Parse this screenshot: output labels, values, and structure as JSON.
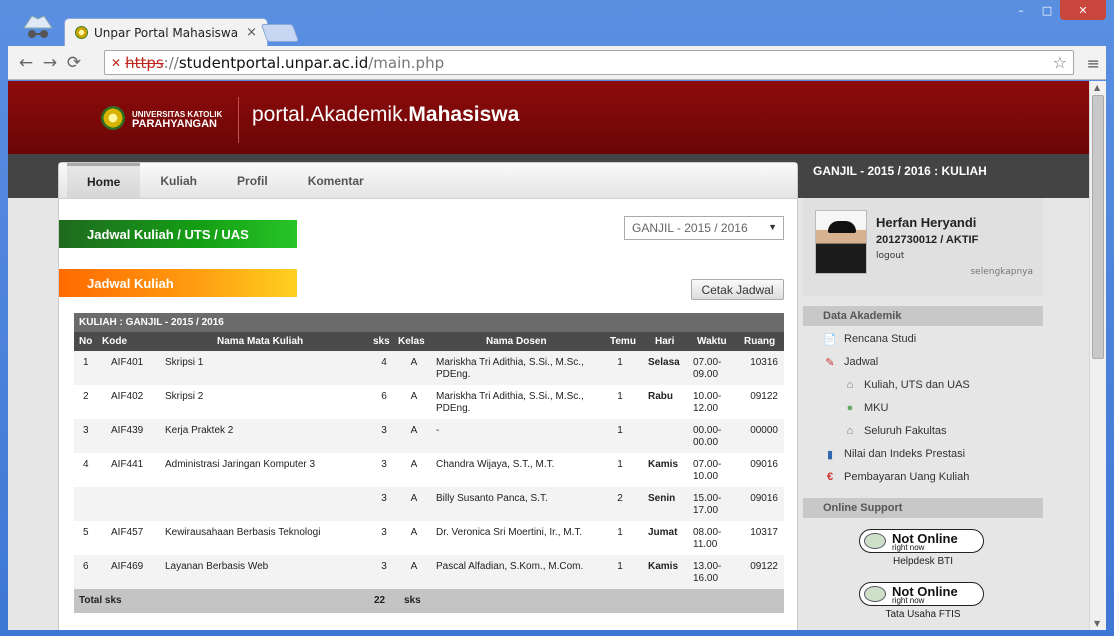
{
  "browser": {
    "tab_title": "Unpar Portal Mahasiswa",
    "tab_close": "×",
    "url_protocol": "https",
    "url_separator": "://",
    "url_host": "studentportal.unpar.ac.id",
    "url_path": "/main.php",
    "back": "←",
    "forward": "→",
    "reload": "⟳",
    "menu": "≡",
    "star": "☆",
    "win_min": "–",
    "win_max": "□",
    "win_close": "✕"
  },
  "header": {
    "uni_line1": "UNIVERSITAS KATOLIK",
    "uni_line2": "PARAHYANGAN",
    "portal_prefix": "portal.Akademik.",
    "portal_bold": "Mahasiswa",
    "semester_label": "GANJIL - 2015 / 2016 : KULIAH"
  },
  "nav": {
    "items": [
      "Home",
      "Kuliah",
      "Profil",
      "Komentar"
    ]
  },
  "main": {
    "section1": "Jadwal Kuliah / UTS / UAS",
    "section2": "Jadwal Kuliah",
    "semester_select": "GANJIL - 2015 / 2016",
    "print_button": "Cetak Jadwal"
  },
  "table": {
    "caption": "KULIAH : GANJIL - 2015 / 2016",
    "headers": [
      "No",
      "Kode",
      "Nama Mata Kuliah",
      "sks",
      "Kelas",
      "Nama Dosen",
      "Temu",
      "Hari",
      "Waktu",
      "Ruang"
    ],
    "rows": [
      {
        "no": "1",
        "kode": "AIF401",
        "nama": "Skripsi 1",
        "sks": "4",
        "kelas": "A",
        "dosen": "Mariskha Tri Adithia, S.Si., M.Sc., PDEng.",
        "temu": "1",
        "hari": "Selasa",
        "waktu": "07.00-09.00",
        "ruang": "10316"
      },
      {
        "no": "2",
        "kode": "AIF402",
        "nama": "Skripsi 2",
        "sks": "6",
        "kelas": "A",
        "dosen": "Mariskha Tri Adithia, S.Si., M.Sc., PDEng.",
        "temu": "1",
        "hari": "Rabu",
        "waktu": "10.00-12.00",
        "ruang": "09122"
      },
      {
        "no": "3",
        "kode": "AIF439",
        "nama": "Kerja Praktek 2",
        "sks": "3",
        "kelas": "A",
        "dosen": "-",
        "temu": "1",
        "hari": "",
        "waktu": "00.00-00.00",
        "ruang": "00000"
      },
      {
        "no": "4",
        "kode": "AIF441",
        "nama": "Administrasi Jaringan Komputer 3",
        "sks": "3",
        "kelas": "A",
        "dosen": "Chandra Wijaya, S.T., M.T.",
        "temu": "1",
        "hari": "Kamis",
        "waktu": "07.00-10.00",
        "ruang": "09016"
      },
      {
        "no": "",
        "kode": "",
        "nama": "",
        "sks": "3",
        "kelas": "A",
        "dosen": "Billy Susanto Panca, S.T.",
        "temu": "2",
        "hari": "Senin",
        "waktu": "15.00-17.00",
        "ruang": "09016"
      },
      {
        "no": "5",
        "kode": "AIF457",
        "nama": "Kewirausahaan Berbasis Teknologi",
        "sks": "3",
        "kelas": "A",
        "dosen": "Dr. Veronica Sri Moertini, Ir., M.T.",
        "temu": "1",
        "hari": "Jumat",
        "waktu": "08.00-11.00",
        "ruang": "10317"
      },
      {
        "no": "6",
        "kode": "AIF469",
        "nama": "Layanan Berbasis Web",
        "sks": "3",
        "kelas": "A",
        "dosen": "Pascal Alfadian, S.Kom., M.Com.",
        "temu": "1",
        "hari": "Kamis",
        "waktu": "13.00-16.00",
        "ruang": "09122"
      }
    ],
    "total_label": "Total sks",
    "total_value": "22",
    "total_unit": "sks"
  },
  "profile": {
    "name": "Herfan Heryandi",
    "npm_status": "2012730012 / AKTIF",
    "logout": "logout",
    "more": "selengkapnya"
  },
  "sidebar": {
    "data_akademik": "Data Akademik",
    "items": {
      "rencana": "Rencana Studi",
      "jadwal": "Jadwal",
      "kuliah_uts": "Kuliah, UTS dan UAS",
      "mku": "MKU",
      "fakultas": "Seluruh Fakultas",
      "nilai": "Nilai dan Indeks Prestasi",
      "pembayaran": "Pembayaran Uang Kuliah"
    },
    "online_support": "Online Support",
    "support1_status": "Not Online",
    "support1_sub": "right now",
    "support1_name": "Helpdesk BTI",
    "support2_status": "Not Online",
    "support2_sub": "right now",
    "support2_name": "Tata Usaha FTIS"
  }
}
